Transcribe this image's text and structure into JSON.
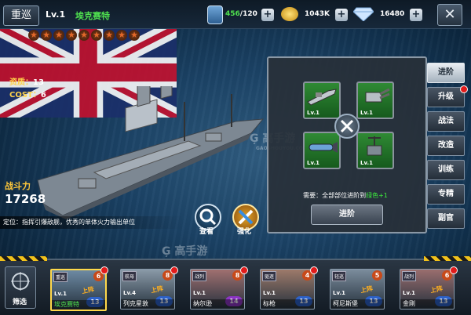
{
  "ship": {
    "type_label": "重巡",
    "level": "Lv.1",
    "name": "埃克赛特",
    "stars": [
      "★",
      "★",
      "★",
      "★",
      "★",
      "★",
      "★",
      "★",
      "★"
    ],
    "quality_label": "资质：",
    "quality_value": "13",
    "cost_label": "COST：",
    "cost_value": "6",
    "power_label": "战斗力",
    "power_value": "17268",
    "description": "定位：指挥引爆敌舰，优秀的单体火力输出单位"
  },
  "resources": {
    "fuel": "456",
    "fuel_max": "/120",
    "gold": "1043K",
    "diamonds": "16480",
    "plus": "+"
  },
  "close_label": "✕",
  "actions": {
    "view": "查看",
    "strengthen": "强化"
  },
  "panel": {
    "parts": [
      {
        "level": "Lv.1",
        "icon": "cannon-icon"
      },
      {
        "level": "Lv.1",
        "icon": "turret-icon"
      },
      {
        "level": "Lv.1",
        "icon": "torpedo-icon"
      },
      {
        "level": "Lv.1",
        "icon": "radar-icon"
      }
    ],
    "requirement_prefix": "需要：全部部位进阶到",
    "requirement_highlight": "绿色+1",
    "advance_button": "进阶"
  },
  "side_tabs": [
    {
      "label": "进阶",
      "active": true,
      "dot": false
    },
    {
      "label": "升级",
      "active": false,
      "dot": true
    },
    {
      "label": "战法",
      "active": false,
      "dot": false
    },
    {
      "label": "改造",
      "active": false,
      "dot": false
    },
    {
      "label": "训练",
      "active": false,
      "dot": false
    },
    {
      "label": "专精",
      "active": false,
      "dot": false
    },
    {
      "label": "副官",
      "active": false,
      "dot": false
    }
  ],
  "watermark": {
    "text": "Ģ 高手游",
    "sub": "GAOSHOUYOU.COM"
  },
  "bottom": {
    "filter_label": "筛选",
    "cards": [
      {
        "type": "重巡",
        "stars": "6",
        "level_label": "Lv.1",
        "name": "埃克赛特",
        "onboard": "上阵",
        "grade": "13",
        "grade_color": "blue",
        "selected": true,
        "dot": true
      },
      {
        "type": "航母",
        "stars": "8",
        "level_label": "Lv.4",
        "name": "列克星敦",
        "onboard": "上阵",
        "grade": "13",
        "grade_color": "blue",
        "selected": false,
        "dot": true
      },
      {
        "type": "战列",
        "stars": "8",
        "level_label": "Lv.1",
        "name": "纳尔逊",
        "onboard": "",
        "grade": "14",
        "grade_color": "purple",
        "selected": false,
        "dot": true
      },
      {
        "type": "驱逐",
        "stars": "4",
        "level_label": "Lv.1",
        "name": "标枪",
        "onboard": "",
        "grade": "13",
        "grade_color": "blue",
        "selected": false,
        "dot": true
      },
      {
        "type": "轻巡",
        "stars": "5",
        "level_label": "Lv.1",
        "name": "柯尼斯堡",
        "onboard": "上阵",
        "grade": "13",
        "grade_color": "blue",
        "selected": false,
        "dot": false
      },
      {
        "type": "战列",
        "stars": "6",
        "level_label": "Lv.1",
        "name": "金刚",
        "onboard": "上阵",
        "grade": "13",
        "grade_color": "blue",
        "selected": false,
        "dot": true
      }
    ]
  }
}
